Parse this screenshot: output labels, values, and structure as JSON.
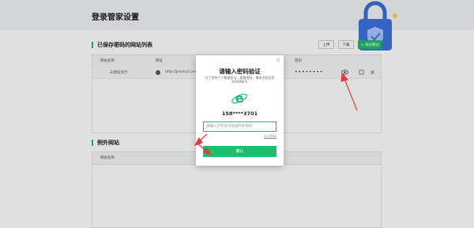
{
  "page": {
    "title": "登录管家设置"
  },
  "saved": {
    "section_title": "已保存密码的网站列表",
    "buttons": {
      "upload": "上传",
      "download": "下载",
      "add": "+ 添加网站"
    },
    "columns": {
      "site_name": "网站名称",
      "url": "网址",
      "password": "密码"
    },
    "rows": [
      {
        "name": "天使投资行",
        "url": "http://product.yes",
        "password": "••••••••"
      }
    ]
  },
  "exceptions": {
    "section_title": "例外网站",
    "columns": {
      "site_name": "网站名称"
    }
  },
  "modal": {
    "title": "请输入密码验证",
    "description": "为了您的个人数据安全，查看密码，需再次验证您的360账号",
    "account": "158****3701",
    "input_placeholder": "请输入您登录浏览器时的密码",
    "forgot": "忘记密码",
    "confirm": "确认",
    "close": "×"
  },
  "colors": {
    "accent": "#1fbd6e",
    "annotation": "#e23c3c"
  }
}
